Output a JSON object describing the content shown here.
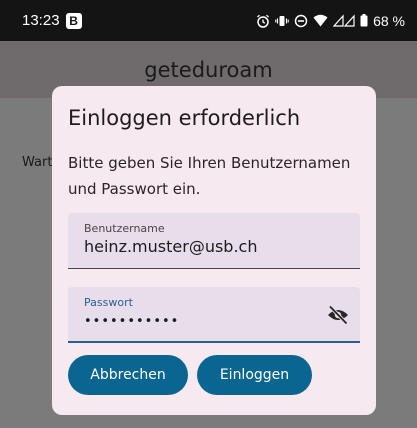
{
  "status_bar": {
    "time": "13:23",
    "notification_badge": "B",
    "battery": "68 %",
    "icons": [
      "alarm-icon",
      "vibrate-icon",
      "do-not-disturb-icon",
      "wifi-icon",
      "signal-icon",
      "battery-icon"
    ]
  },
  "app": {
    "title": "geteduroam",
    "wait_text": "Wart"
  },
  "dialog": {
    "title": "Einloggen erforderlich",
    "message": "Bitte geben Sie Ihren Benutzernamen und Passwort ein.",
    "username": {
      "label": "Benutzername",
      "value": "heinz.muster@usb.ch"
    },
    "password": {
      "label": "Passwort",
      "value": "•••••••••••",
      "toggle_icon": "visibility-off-icon"
    },
    "buttons": {
      "cancel": "Abbrechen",
      "login": "Einloggen"
    }
  },
  "colors": {
    "accent": "#0a6690",
    "dialog_bg": "#f6e9ef",
    "field_bg": "#e8ddea",
    "focus": "#2b5f91"
  }
}
